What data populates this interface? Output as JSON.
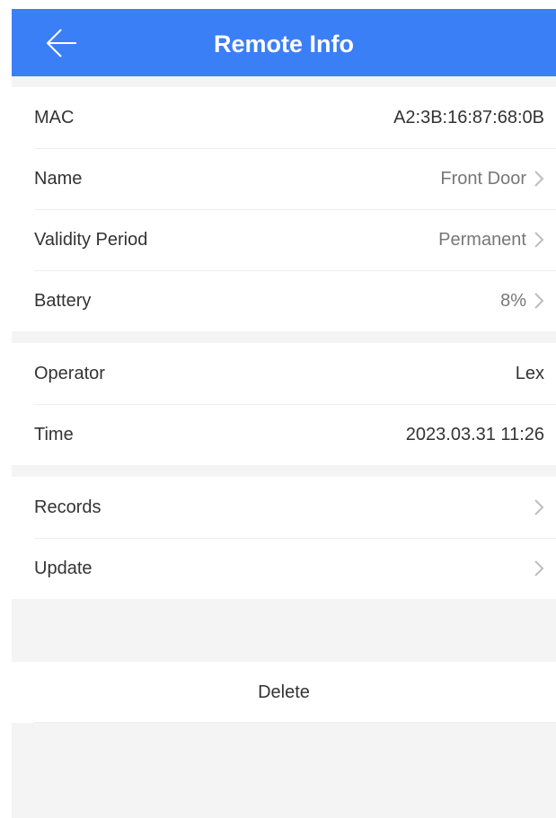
{
  "header": {
    "title": "Remote Info",
    "back_icon": "arrow-left-icon"
  },
  "info": {
    "mac": {
      "label": "MAC",
      "value": "A2:3B:16:87:68:0B"
    },
    "name": {
      "label": "Name",
      "value": "Front Door"
    },
    "validity": {
      "label": "Validity Period",
      "value": "Permanent"
    },
    "battery": {
      "label": "Battery",
      "value": "8%"
    }
  },
  "meta": {
    "operator": {
      "label": "Operator",
      "value": "Lex"
    },
    "time": {
      "label": "Time",
      "value": "2023.03.31 11:26"
    }
  },
  "actions": {
    "records": {
      "label": "Records"
    },
    "update": {
      "label": "Update"
    }
  },
  "delete": {
    "label": "Delete"
  },
  "colors": {
    "header_bg": "#3b7ff6",
    "page_bg": "#f4f4f4",
    "chevron": "#bdbdbd"
  }
}
